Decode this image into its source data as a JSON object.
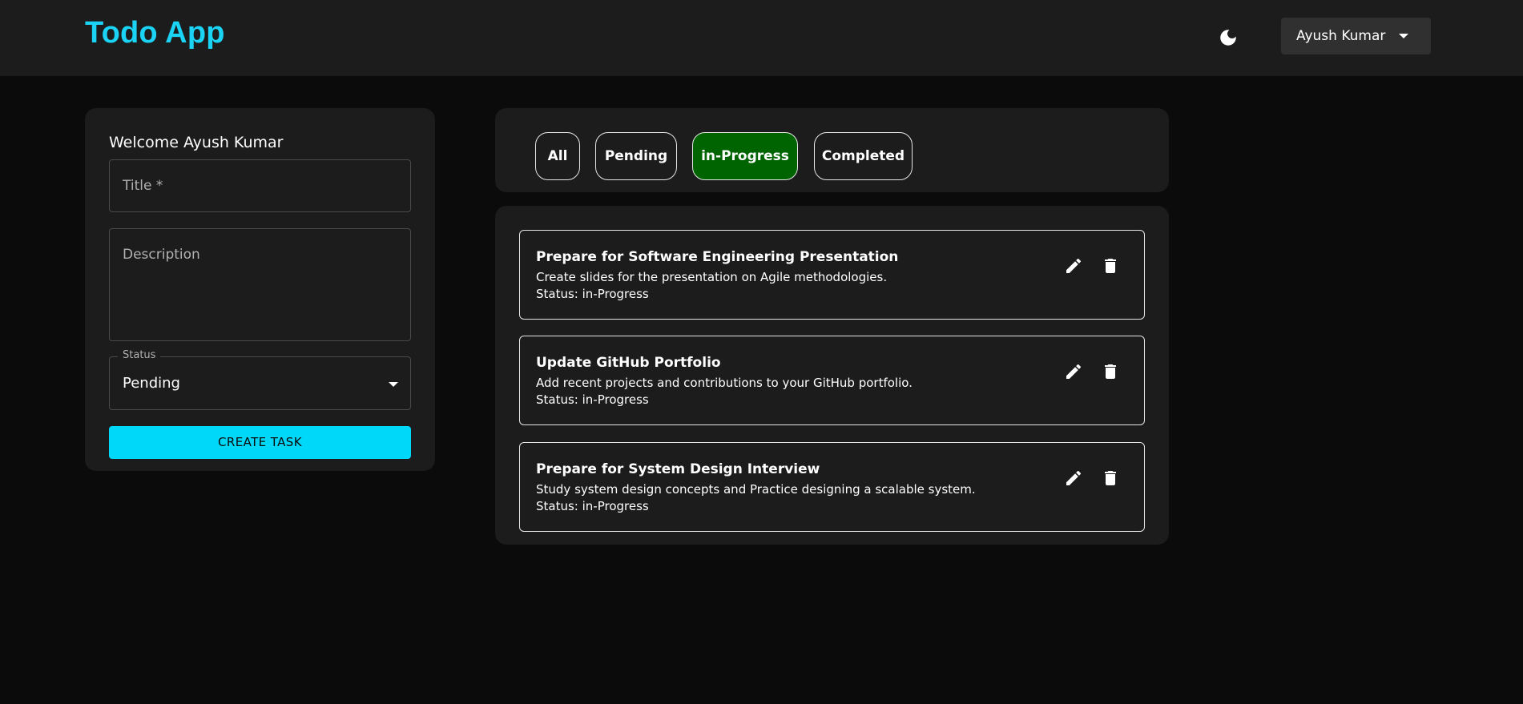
{
  "header": {
    "app_title": "Todo App",
    "theme_icon": "moon-icon",
    "user_name": "Ayush Kumar"
  },
  "form": {
    "welcome": "Welcome Ayush Kumar",
    "title_placeholder": "Title *",
    "description_placeholder": "Description",
    "status_label": "Status",
    "status_value": "Pending",
    "submit_label": "CREATE TASK"
  },
  "filters": {
    "active": "in-Progress",
    "active_color": "#006400",
    "items": [
      {
        "label": "All"
      },
      {
        "label": "Pending"
      },
      {
        "label": "in-Progress"
      },
      {
        "label": "Completed"
      }
    ]
  },
  "tasks": [
    {
      "title": "Prepare for Software Engineering Presentation",
      "description": "Create slides for the presentation on Agile methodologies.",
      "status": "Status: in-Progress"
    },
    {
      "title": "Update GitHub Portfolio",
      "description": "Add recent projects and contributions to your GitHub portfolio.",
      "status": "Status: in-Progress"
    },
    {
      "title": "Prepare for System Design Interview",
      "description": "Study system design concepts and Practice designing a scalable system.",
      "status": "Status: in-Progress"
    }
  ],
  "colors": {
    "accent": "#1ad3f5",
    "button": "#00d8fa",
    "background": "#0b0b0b",
    "card": "#1c1c1c"
  }
}
